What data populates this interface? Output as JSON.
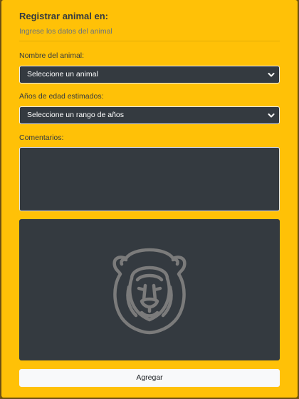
{
  "form": {
    "title": "Registrar animal en:",
    "subtitle": "Ingrese los datos del animal",
    "animal_label": "Nombre del animal:",
    "animal_select": {
      "value": "Seleccione un animal"
    },
    "age_label": "Años de edad estimados:",
    "age_select": {
      "value": "Seleccione un rango de años"
    },
    "comments_label": "Comentarios:",
    "comments_value": "",
    "preview_icon": "lion-icon",
    "add_button": "Agregar"
  },
  "colors": {
    "card_background": "#ffc107",
    "field_background": "#343a40",
    "button_background": "#f8f9fa"
  }
}
